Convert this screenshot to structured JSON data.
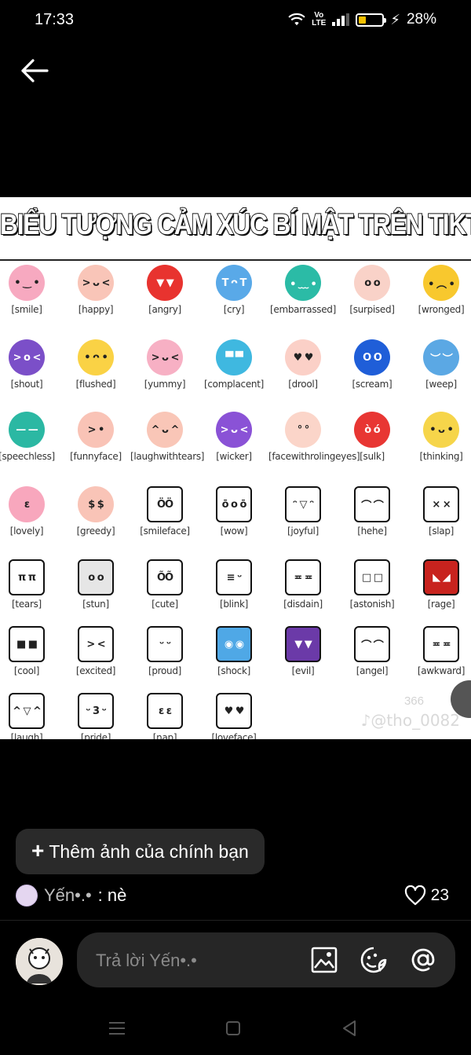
{
  "status": {
    "time": "17:33",
    "volte": "Vo\nLTE",
    "battery": "28%",
    "battery_level": 0.28
  },
  "poster": {
    "title": "BIỂU TƯỢNG CẢM XÚC BÍ MẬT TRÊN TIKTOK",
    "watermark": "♪@tho_0082",
    "faint_count": "366",
    "emojis": [
      {
        "label": "[smile]",
        "color": "#f7a9c0",
        "face": "• ‿ •",
        "style": "round"
      },
      {
        "label": "[happy]",
        "color": "#f9c5b8",
        "face": "> ᴗ <",
        "style": "round"
      },
      {
        "label": "[angry]",
        "color": "#e8332f",
        "face": "▼ ▼",
        "style": "round"
      },
      {
        "label": "[cry]",
        "color": "#59a9e8",
        "face": "T ᴖ T",
        "style": "round"
      },
      {
        "label": "[embarrassed]",
        "color": "#2bbba6",
        "face": "• ﹏ •",
        "style": "round"
      },
      {
        "label": "[surpised]",
        "color": "#f9d2c8",
        "face": "o o",
        "style": "round"
      },
      {
        "label": "[wronged]",
        "color": "#f8c82e",
        "face": "• ︵ •",
        "style": "round"
      },
      {
        "label": "[shout]",
        "color": "#7b4fc8",
        "face": "> o <",
        "style": "round"
      },
      {
        "label": "[flushed]",
        "color": "#fad245",
        "face": "• ᴖ •",
        "style": "round"
      },
      {
        "label": "[yummy]",
        "color": "#f7b0c4",
        "face": "> ᴗ <",
        "style": "round"
      },
      {
        "label": "[complacent]",
        "color": "#3fb8e0",
        "face": "▀ ▀",
        "style": "round"
      },
      {
        "label": "[drool]",
        "color": "#fbd0c7",
        "face": "♥ ♥",
        "style": "round"
      },
      {
        "label": "[scream]",
        "color": "#1f5ed8",
        "face": "O O",
        "style": "round"
      },
      {
        "label": "[weep]",
        "color": "#5ba8e4",
        "face": "︶ ︶",
        "style": "round"
      },
      {
        "label": "[speechless]",
        "color": "#2bb8a3",
        "face": "— —",
        "style": "round"
      },
      {
        "label": "[funnyface]",
        "color": "#f9c3b6",
        "face": "> •",
        "style": "round"
      },
      {
        "label": "[laughwithtears]",
        "color": "#f9c6b7",
        "face": "^ ᴗ ^",
        "style": "round"
      },
      {
        "label": "[wicker]",
        "color": "#8a52d6",
        "face": "> ᴗ <",
        "style": "round"
      },
      {
        "label": "[facewithrolingeyes]",
        "color": "#fbd5c9",
        "face": "° °",
        "style": "round"
      },
      {
        "label": "[sulk]",
        "color": "#e83633",
        "face": "ò ó",
        "style": "round"
      },
      {
        "label": "[thinking]",
        "color": "#f6d54a",
        "face": "• ᴗ •",
        "style": "round"
      },
      {
        "label": "[lovely]",
        "color": "#f8a7bd",
        "face": "ε",
        "style": "round"
      },
      {
        "label": "[greedy]",
        "color": "#f9c4b7",
        "face": "$ $",
        "style": "round"
      },
      {
        "label": "[smileface]",
        "color": "#ffffff",
        "face": "ÖÖ",
        "style": "box"
      },
      {
        "label": "[wow]",
        "color": "#ffffff",
        "face": "ō o ō",
        "style": "box"
      },
      {
        "label": "[joyful]",
        "color": "#ffffff",
        "face": "ᵔ ▽ ᵔ",
        "style": "box"
      },
      {
        "label": "[hehe]",
        "color": "#ffffff",
        "face": "⌒ ⌒",
        "style": "box"
      },
      {
        "label": "[slap]",
        "color": "#ffffff",
        "face": "× ×",
        "style": "box"
      },
      {
        "label": "[tears]",
        "color": "#ffffff",
        "face": "π π",
        "style": "box"
      },
      {
        "label": "[stun]",
        "color": "#e6e6e6",
        "face": "o o",
        "style": "box"
      },
      {
        "label": "[cute]",
        "color": "#ffffff",
        "face": "ÕÕ",
        "style": "box"
      },
      {
        "label": "[blink]",
        "color": "#ffffff",
        "face": "≡ ᵕ",
        "style": "box"
      },
      {
        "label": "[disdain]",
        "color": "#ffffff",
        "face": "≖ ≖",
        "style": "box"
      },
      {
        "label": "[astonish]",
        "color": "#ffffff",
        "face": "□ □",
        "style": "box"
      },
      {
        "label": "[rage]",
        "color": "#c8231e",
        "face": "◣ ◢",
        "style": "box"
      },
      {
        "label": "[cool]",
        "color": "#ffffff",
        "face": "■ ■",
        "style": "box"
      },
      {
        "label": "[excited]",
        "color": "#ffffff",
        "face": "> <",
        "style": "box"
      },
      {
        "label": "[proud]",
        "color": "#ffffff",
        "face": "ᵕ ᵕ",
        "style": "box"
      },
      {
        "label": "[shock]",
        "color": "#4fa8e6",
        "face": "◉ ◉",
        "style": "box"
      },
      {
        "label": "[evil]",
        "color": "#6b3aa8",
        "face": "▼ ▼",
        "style": "box"
      },
      {
        "label": "[angel]",
        "color": "#ffffff",
        "face": "⌒ ⌒",
        "style": "box"
      },
      {
        "label": "[awkward]",
        "color": "#ffffff",
        "face": "≖ ≖",
        "style": "box"
      },
      {
        "label": "[laugh]",
        "color": "#ffffff",
        "face": "^ ▽ ^",
        "style": "box"
      },
      {
        "label": "[pride]",
        "color": "#ffffff",
        "face": "ᵕ 3 ᵕ",
        "style": "box"
      },
      {
        "label": "[nap]",
        "color": "#ffffff",
        "face": "ε ε",
        "style": "box"
      },
      {
        "label": "[loveface]",
        "color": "#ffffff",
        "face": "♥ ♥",
        "style": "box"
      }
    ]
  },
  "add_button": {
    "plus": "+",
    "label": "Thêm ảnh của chính bạn"
  },
  "caption": {
    "user": "Yến•.•",
    "text": ": nè"
  },
  "likes": {
    "count": "23",
    "icon": "heart-icon"
  },
  "reply": {
    "placeholder": "Trả lời Yến•.•"
  },
  "colors": {
    "background": "#000000",
    "input_bg": "#262626",
    "button_bg": "#2a2a2a"
  }
}
